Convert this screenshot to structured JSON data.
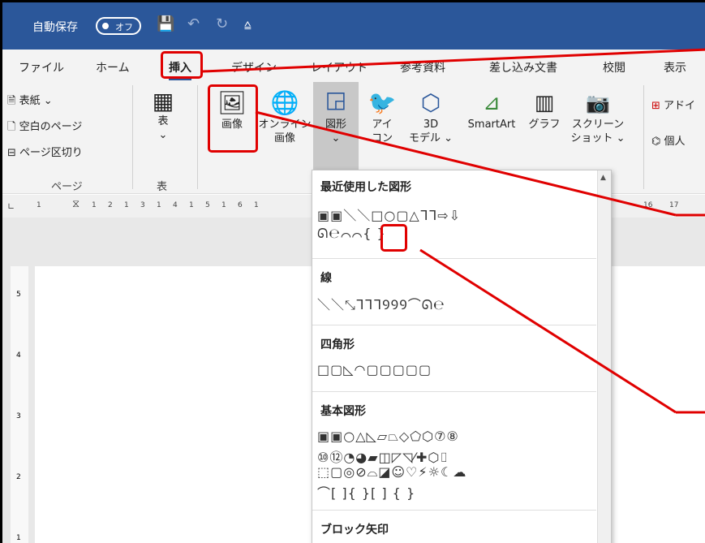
{
  "titlebar": {
    "autosave": "自動保存",
    "toggle": "オフ"
  },
  "tabs": [
    "ファイル",
    "ホーム",
    "挿入",
    "デザイン",
    "レイアウト",
    "参考資料",
    "差し込み文書",
    "校閲",
    "表示"
  ],
  "ribbon": {
    "page_items": [
      "表紙",
      "空白のページ",
      "ページ区切り"
    ],
    "page_group": "ページ",
    "table_label": "表",
    "table_group": "表",
    "image": "画像",
    "online_image": [
      "オンライン",
      "画像"
    ],
    "shapes": "図形",
    "icons": [
      "アイ",
      "コン"
    ],
    "model3d": [
      "3D",
      "モデル"
    ],
    "smartart": "SmartArt",
    "graph": "グラフ",
    "screenshot": [
      "スクリーン",
      "ショット"
    ],
    "addin": "アドイ",
    "personal": "個人"
  },
  "ruler_numbers": [
    "1",
    "1",
    "1",
    "2",
    "1",
    "3",
    "1",
    "4",
    "1",
    "5",
    "1",
    "6",
    "1",
    "16",
    "1",
    "17",
    "1"
  ],
  "vruler_numbers": [
    "5",
    "4",
    "3",
    "2",
    "1"
  ],
  "dropdown": {
    "recent": "最近使用した図形",
    "recent_row1": "▣▣＼＼□○▢△ᒣᒣ⇨⇩",
    "recent_row2": "ᘏ℮⌒⌒{ }",
    "lines": "線",
    "lines_row": "＼＼⤡ᒣᒣᒣꝮꝮꝮ⌒ᘏ℮",
    "rects": "四角形",
    "rects_row": "□▢◺◠▢▢▢▢▢",
    "basic": "基本図形",
    "basic_row1": "▣▣○△◺▱⏢◇⬠⬡⑦⑧",
    "basic_row2": "⑩⑫◔◕▰◫◸◹⁄✚⬡⌷",
    "basic_row3": "⬚▢◎⊘⌓◪☺♡⚡☼☾☁",
    "basic_row4": "⌒[ ]{ }[ ] { }",
    "block": "ブロック矢印"
  },
  "colors": {
    "titlebar": "#2b579a",
    "highlight": "#e00000",
    "ribbon": "#f3f3f3"
  }
}
